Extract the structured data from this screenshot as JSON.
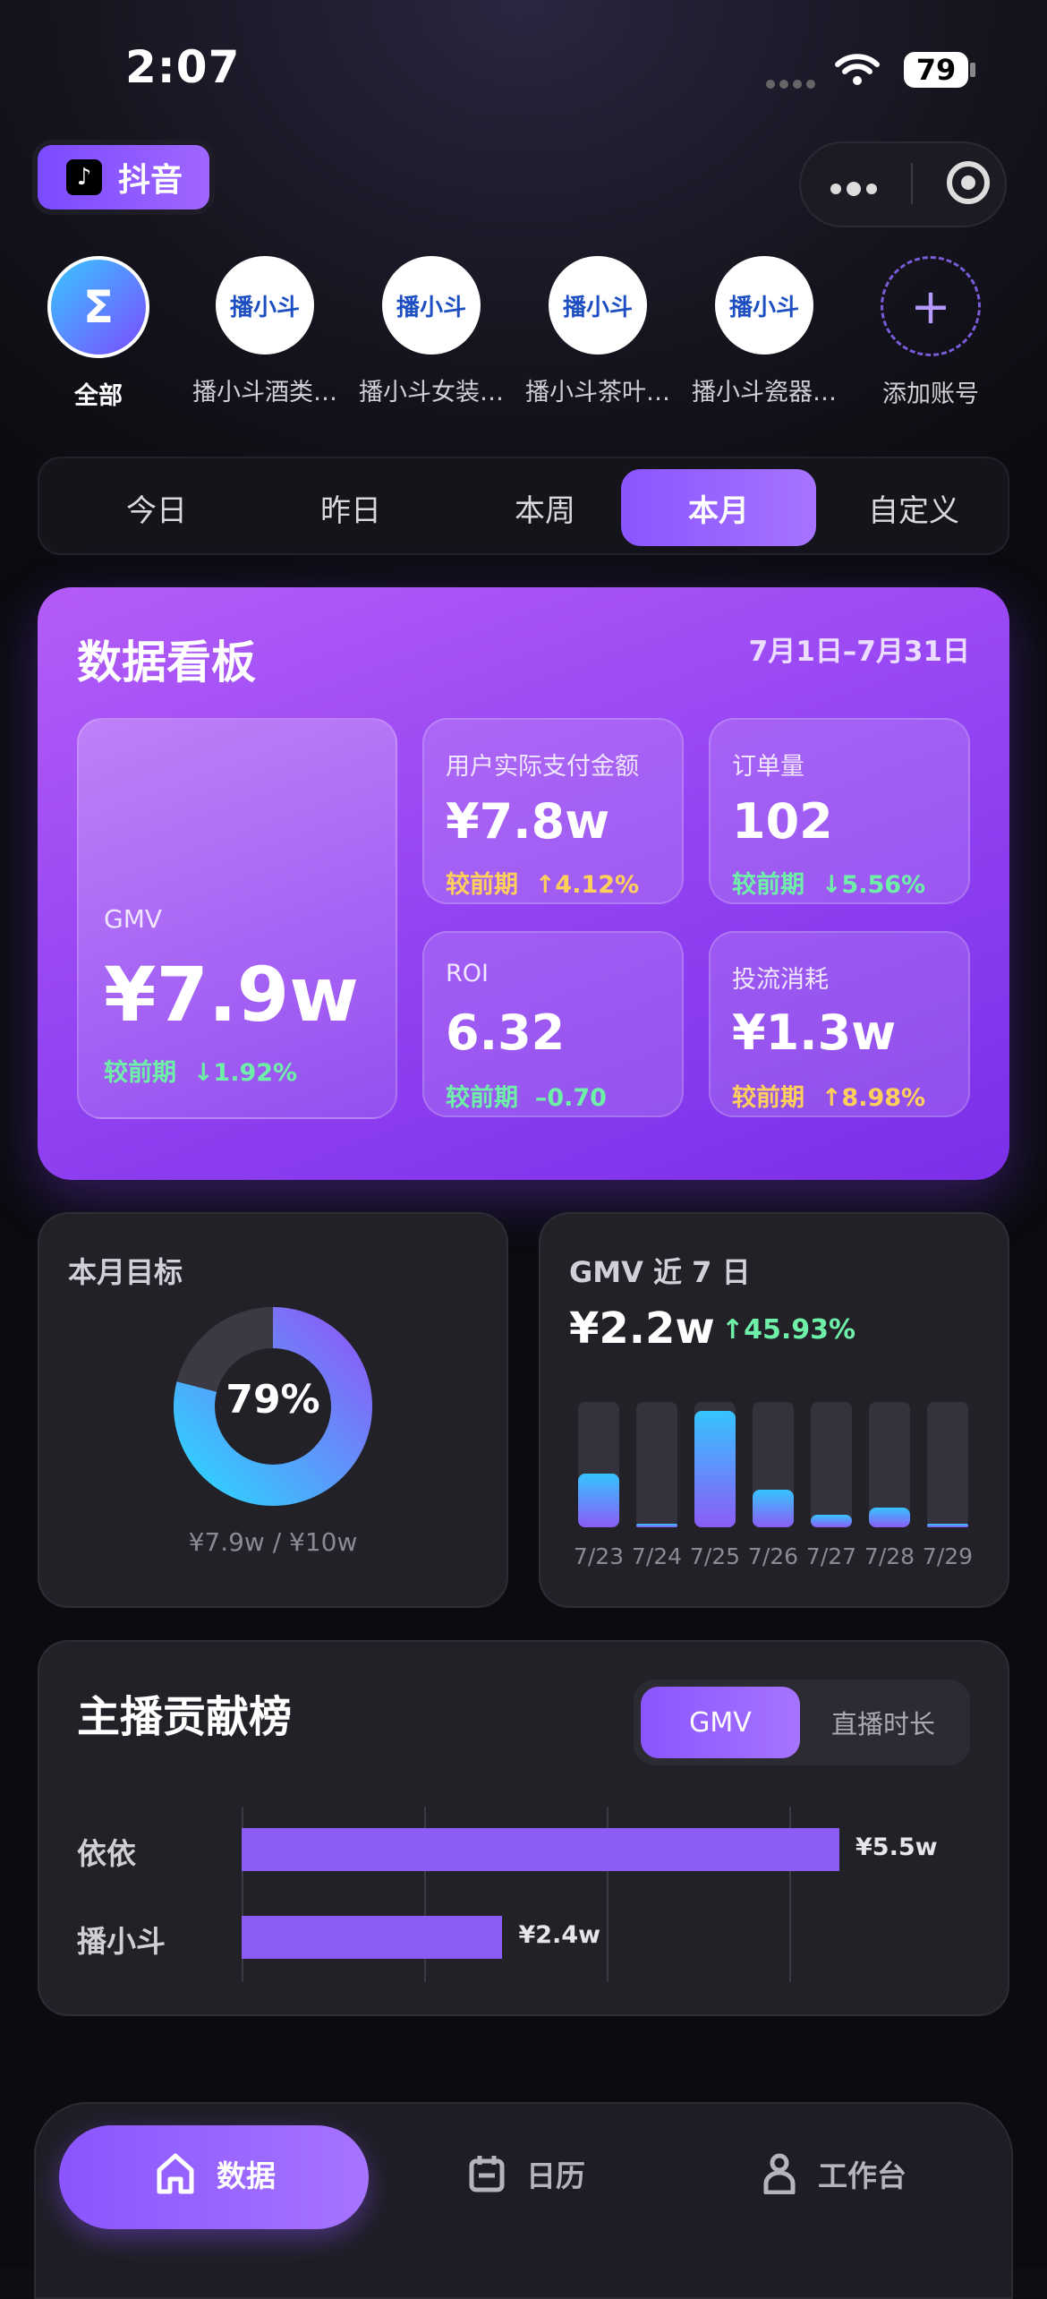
{
  "status_bar": {
    "time": "2:07",
    "battery": "79"
  },
  "platform_badge": {
    "icon": "douyin-icon",
    "label": "抖音"
  },
  "mini_program_capsule": {
    "menu_icon": "more-dots-icon",
    "close_icon": "target-icon"
  },
  "accounts": [
    {
      "label": "全部",
      "avatar": "Σ",
      "active": true
    },
    {
      "label": "播小斗酒类…",
      "avatar": "播小斗"
    },
    {
      "label": "播小斗女装…",
      "avatar": "播小斗"
    },
    {
      "label": "播小斗茶叶…",
      "avatar": "播小斗"
    },
    {
      "label": "播小斗瓷器…",
      "avatar": "播小斗"
    },
    {
      "label": "添加账号",
      "avatar": "+"
    }
  ],
  "period_tabs": [
    {
      "label": "今日"
    },
    {
      "label": "昨日"
    },
    {
      "label": "本周"
    },
    {
      "label": "本月",
      "active": true
    },
    {
      "label": "自定义"
    }
  ],
  "dashboard": {
    "title": "数据看板",
    "date_range": "7月1日–7月31日",
    "compare_label": "较前期",
    "gmv": {
      "label": "GMV",
      "value": "¥7.9w",
      "change": "↓1.92%",
      "direction": "down"
    },
    "paid": {
      "label": "用户实际支付金额",
      "value": "¥7.8w",
      "change": "↑4.12%",
      "direction": "up"
    },
    "orders": {
      "label": "订单量",
      "value": "102",
      "change": "↓5.56%",
      "direction": "down"
    },
    "roi": {
      "label": "ROI",
      "value": "6.32",
      "change": "–0.70",
      "direction": "down"
    },
    "spend": {
      "label": "投流消耗",
      "value": "¥1.3w",
      "change": "↑8.98%",
      "direction": "up"
    }
  },
  "monthly_goal": {
    "title": "本月目标",
    "percent_label": "79%",
    "progress": 0.79,
    "detail": "¥7.9w / ¥10w"
  },
  "gmv_7d": {
    "title": "GMV 近 7 日",
    "total": "¥2.2w",
    "change": "↑45.93%",
    "chart_data": {
      "type": "bar",
      "categories": [
        "7/23",
        "7/24",
        "7/25",
        "7/26",
        "7/27",
        "7/28",
        "7/29"
      ],
      "values": [
        0.43,
        0.02,
        0.93,
        0.3,
        0.1,
        0.16,
        0.02
      ]
    }
  },
  "ranking": {
    "title": "主播贡献榜",
    "toggle": [
      {
        "label": "GMV",
        "active": true
      },
      {
        "label": "直播时长"
      }
    ],
    "chart_data": {
      "type": "bar",
      "categories": [
        "依依",
        "播小斗"
      ],
      "values": [
        5.5,
        2.4
      ],
      "value_labels": [
        "¥5.5w",
        "¥2.4w"
      ]
    }
  },
  "bottom_nav": [
    {
      "label": "数据",
      "icon": "home-icon",
      "active": true
    },
    {
      "label": "日历",
      "icon": "calendar-icon"
    },
    {
      "label": "工作台",
      "icon": "person-icon"
    }
  ]
}
